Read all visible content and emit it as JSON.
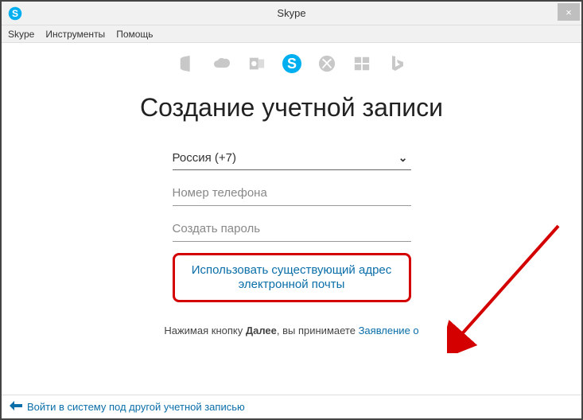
{
  "window": {
    "title": "Skype",
    "close_label": "×"
  },
  "menu": {
    "skype": "Skype",
    "tools": "Инструменты",
    "help": "Помощь"
  },
  "heading": "Создание учетной записи",
  "form": {
    "country": "Россия (+7)",
    "phone_placeholder": "Номер телефона",
    "password_placeholder": "Создать пароль",
    "use_email_link": "Использовать существующий адрес электронной почты"
  },
  "terms": {
    "prefix": "Нажимая кнопку ",
    "bold": "Далее",
    "mid": ", вы принимаете ",
    "link": "Заявление о"
  },
  "footer": {
    "back_link": "Войти в систему под другой учетной записью"
  }
}
